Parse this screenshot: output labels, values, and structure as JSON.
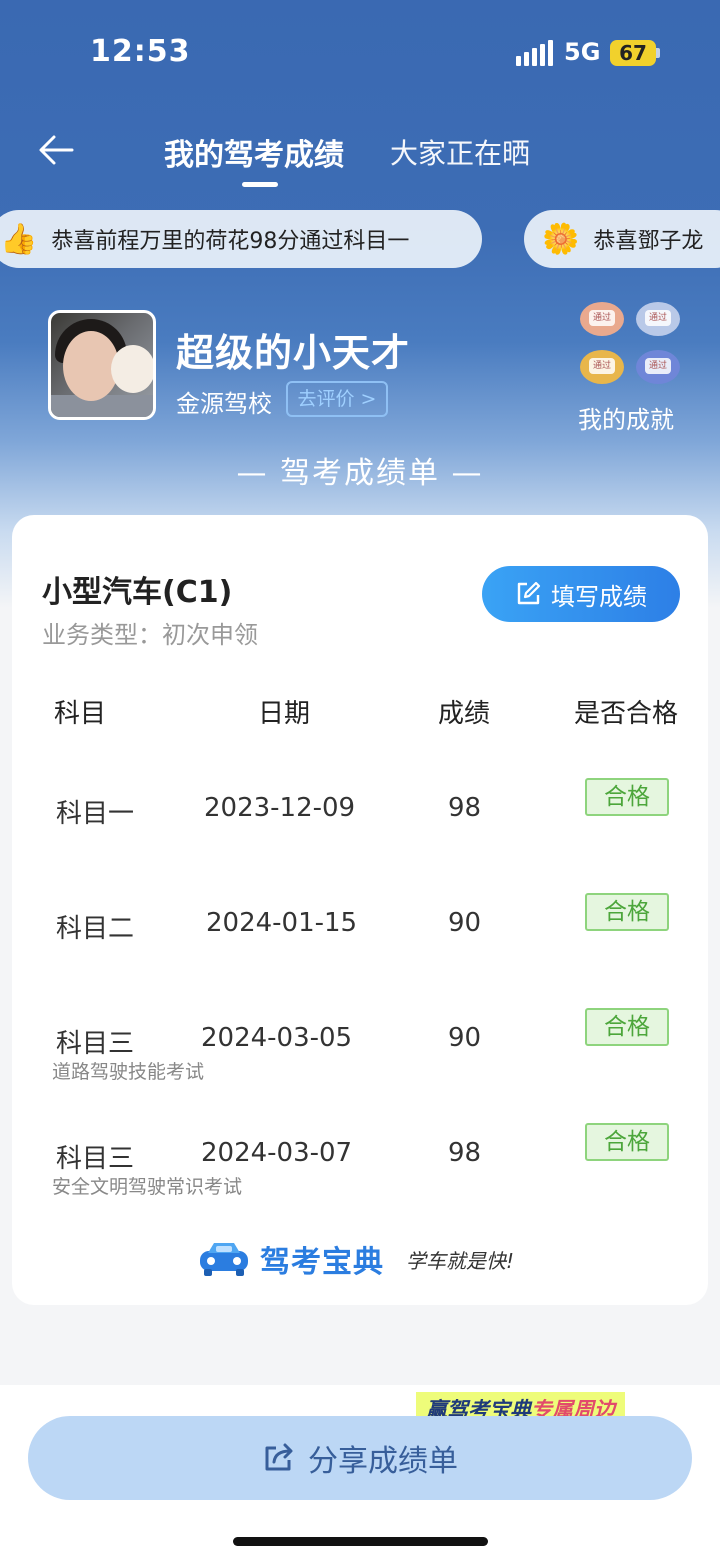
{
  "status": {
    "time": "12:53",
    "network": "5G",
    "battery": "67"
  },
  "nav": {
    "active_tab": "我的驾考成绩",
    "other_tab": "大家正在晒"
  },
  "ticker": [
    {
      "emoji": "👍",
      "text": "恭喜前程万里的荷花98分通过科目一"
    },
    {
      "emoji": "🌼",
      "text": "恭喜鄧子龙"
    }
  ],
  "profile": {
    "name": "超级的小天才",
    "school": "金源驾校",
    "rate_label": "去评价 >",
    "achievements_label": "我的成就",
    "badge_text": [
      "通过",
      "通过",
      "通过",
      "通过"
    ]
  },
  "sheet_title": "— 驾考成绩单 —",
  "card": {
    "license": "小型汽车(C1)",
    "business_type": "业务类型：初次申领",
    "fill_button": "填写成绩",
    "headers": [
      "科目",
      "日期",
      "成绩",
      "是否合格"
    ],
    "rows": [
      {
        "subject": "科目一",
        "date": "2023-12-09",
        "score": "98",
        "result": "合格",
        "note": ""
      },
      {
        "subject": "科目二",
        "date": "2024-01-15",
        "score": "90",
        "result": "合格",
        "note": ""
      },
      {
        "subject": "科目三",
        "date": "2024-03-05",
        "score": "90",
        "result": "合格",
        "note": "道路驾驶技能考试"
      },
      {
        "subject": "科目三",
        "date": "2024-03-07",
        "score": "98",
        "result": "合格",
        "note": "安全文明驾驶常识考试"
      }
    ],
    "logo_name": "驾考宝典",
    "logo_slogan": "学车就是快!"
  },
  "promo": {
    "part1": "赢驾考宝典",
    "part2": "专属周边"
  },
  "share_button": "分享成绩单",
  "colors": {
    "primary": "#2d7fe6",
    "header_bg": "#3a69b2",
    "pass_green": "#4ca63b"
  }
}
